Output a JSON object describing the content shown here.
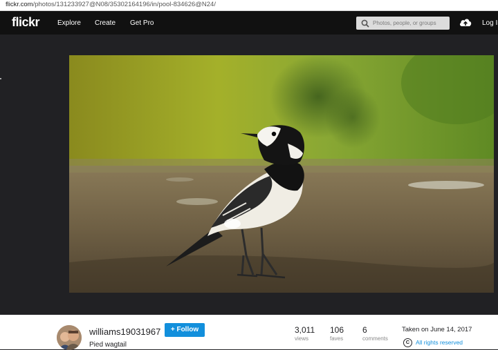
{
  "browser": {
    "url_host": "flickr.com",
    "url_path": "/photos/131233927@N08/35302164196/in/pool-834626@N24/"
  },
  "nav": {
    "logo": "flickr",
    "links": [
      "Explore",
      "Create",
      "Get Pro"
    ],
    "search_placeholder": "Photos, people, or groups",
    "login": "Log In"
  },
  "photo": {
    "subject": "bird",
    "thumbnail_colors": [
      "#7a5a8a",
      "#6b7a3a",
      "#a08a3a",
      "#8a7a3a",
      "#4a6a8a",
      "#5a6a4a",
      "#4a8a3a"
    ]
  },
  "owner": {
    "username": "williams19031967",
    "follow_label": "Follow",
    "photo_title": "Pied wagtail"
  },
  "stats": [
    {
      "value": "3,011",
      "label": "views"
    },
    {
      "value": "106",
      "label": "faves"
    },
    {
      "value": "6",
      "label": "comments"
    }
  ],
  "meta": {
    "taken": "Taken on June 14, 2017",
    "rights": "All rights reserved",
    "rights_symbol": "C"
  },
  "colors": {
    "accent": "#128fdc",
    "nav_bg": "#111111",
    "stage_bg": "#212124"
  }
}
